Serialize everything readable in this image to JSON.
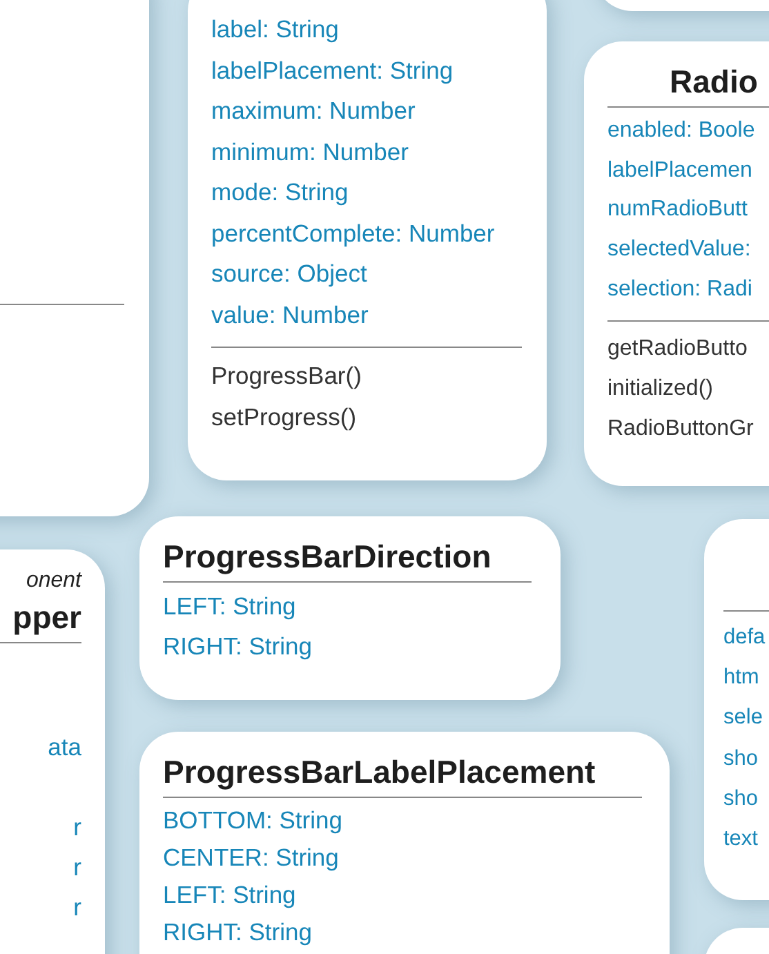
{
  "cards": [
    {
      "attributes": [
        "label: String",
        "labelPlacement: String",
        "maximum: Number",
        "minimum: Number",
        "mode: String",
        "percentComplete: Number",
        "source: Object",
        "value: Number"
      ],
      "methods": [
        "ProgressBar()",
        "setProgress()"
      ]
    },
    {
      "title": "Radio",
      "attributes": [
        "enabled: Boole",
        "labelPlacemen",
        "numRadioButt",
        "selectedValue:",
        "selection: Radi"
      ],
      "methods": [
        "getRadioButto",
        "initialized()",
        "RadioButtonGr"
      ]
    },
    {
      "stereotype": "onent",
      "title": "pper",
      "attributes": [
        "ata",
        "r",
        "r",
        "r"
      ]
    },
    {
      "title": "ProgressBarDirection",
      "attributes": [
        "LEFT: String",
        "RIGHT: String"
      ]
    },
    {
      "title": "ProgressBarLabelPlacement",
      "attributes": [
        "BOTTOM: String",
        "CENTER: String",
        "LEFT: String",
        "RIGHT: String"
      ]
    },
    {
      "attributes": [
        "defa",
        "htm",
        "sele",
        "sho",
        "sho",
        "text"
      ]
    }
  ]
}
